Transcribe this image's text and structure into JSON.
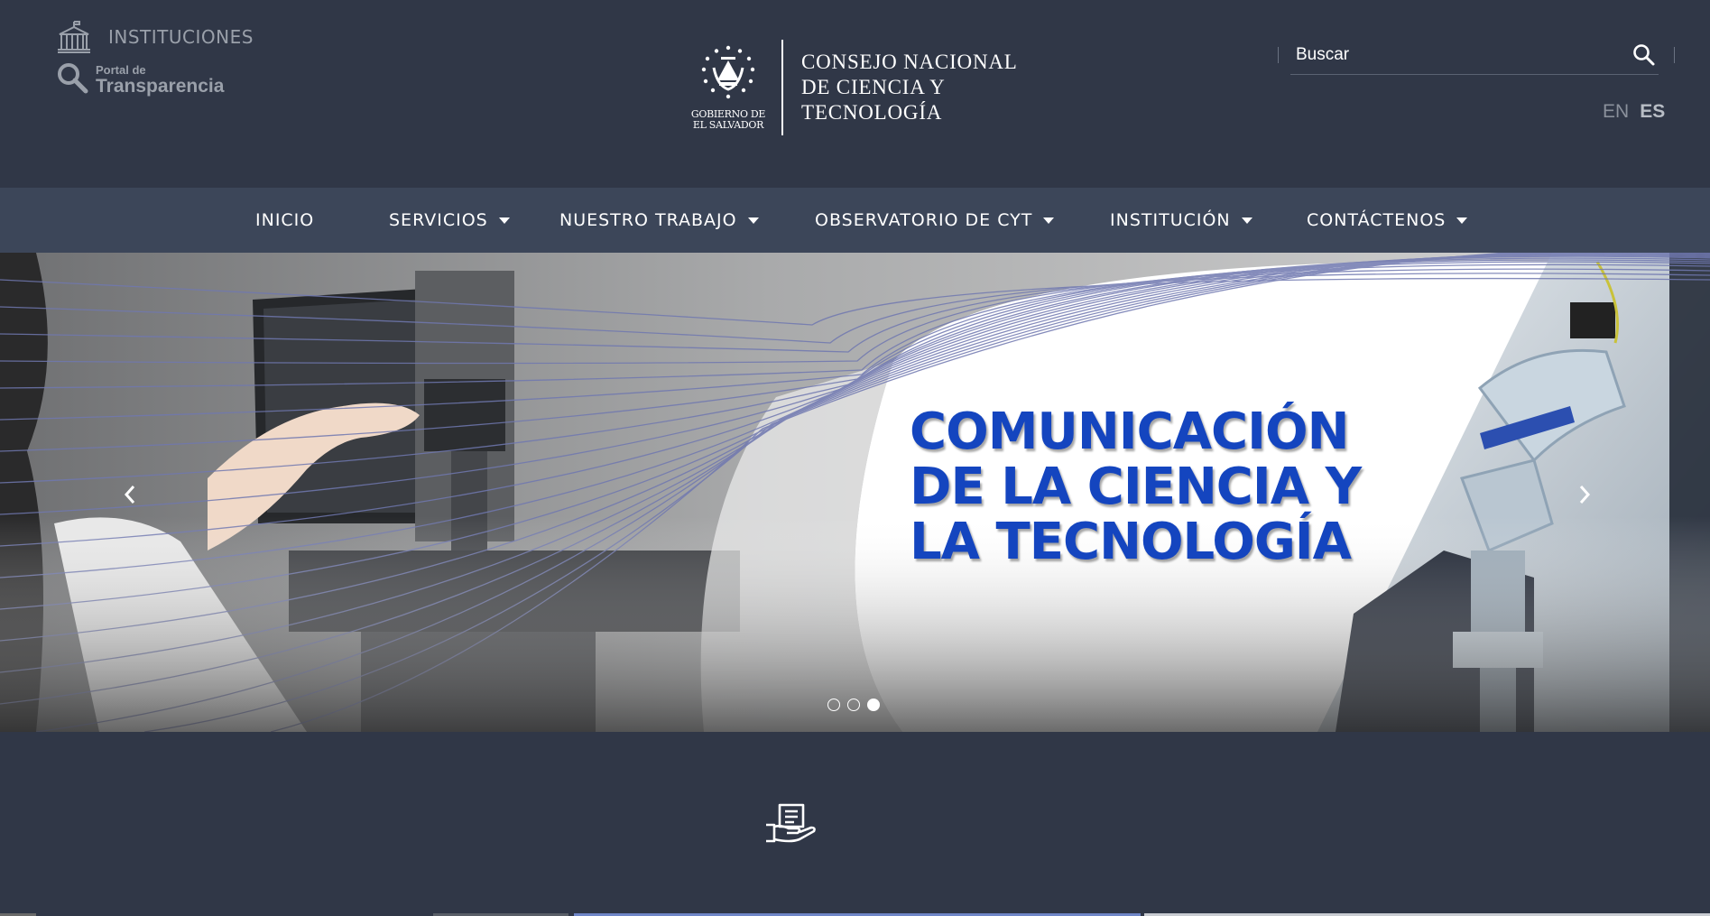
{
  "header": {
    "instituciones_label": "INSTITUCIONES",
    "transparency": {
      "small": "Portal de",
      "big": "Transparencia"
    },
    "logo": {
      "seal_caption_line1": "GOBIERNO DE",
      "seal_caption_line2": "EL SALVADOR",
      "title_line1": "CONSEJO NACIONAL",
      "title_line2": "DE CIENCIA Y",
      "title_line3": "TECNOLOGÍA"
    },
    "search": {
      "placeholder": "Buscar"
    },
    "languages": {
      "en": "EN",
      "es": "ES"
    }
  },
  "nav": {
    "items": [
      {
        "label": "INICIO",
        "dropdown": false
      },
      {
        "label": "SERVICIOS",
        "dropdown": true
      },
      {
        "label": "NUESTRO TRABAJO",
        "dropdown": true
      },
      {
        "label": "OBSERVATORIO DE CYT",
        "dropdown": true
      },
      {
        "label": "INSTITUCIÓN",
        "dropdown": true
      },
      {
        "label": "CONTÁCTENOS",
        "dropdown": true
      }
    ]
  },
  "slider": {
    "headline_line1": "COMUNICACIÓN",
    "headline_line2": "DE LA CIENCIA Y",
    "headline_line3": "LA TECNOLOGÍA",
    "slide_count": 3,
    "active_slide": 3
  },
  "colors": {
    "page_bg": "#303747",
    "nav_bg": "#3c4659",
    "headline_blue": "#1445bf",
    "muted_text": "#9aa0aa"
  },
  "icons": {
    "instituciones": "building-icon",
    "transparency": "magnifier-icon",
    "search": "search-icon",
    "prev": "chevron-left-icon",
    "next": "chevron-right-icon",
    "service": "hand-document-icon",
    "seal": "coat-of-arms-icon"
  }
}
